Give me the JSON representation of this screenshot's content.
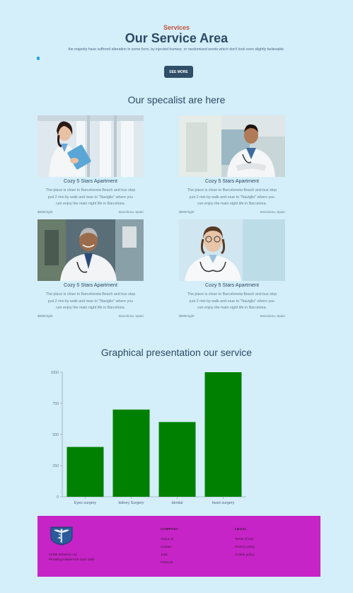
{
  "header": {
    "label": "Services",
    "title": "Our Service Area",
    "subtitle": "the majority have suffered alteration in some form, by injected humour, or randomised words which don't look even slightly believable.",
    "button": "SEE MORE"
  },
  "specialists": {
    "heading": "Our specalist are here",
    "cards": [
      {
        "title": "Cozy 5 Stars Apartment",
        "desc1": "The place is close to Barceloneta Beach and bus stop",
        "desc2": "just 2 min by walk and near to \"Naviglio\" where you",
        "desc3": "can enjoy the main night life in Barcelona.",
        "price": "$699/night",
        "location": "Barcelona, Spain"
      },
      {
        "title": "Cozy 5 Stars Apartment",
        "desc1": "The place is close to Barceloneta Beach and bus stop",
        "desc2": "just 2 min by walk and near to \"Naviglio\" where you",
        "desc3": "can enjoy the main night life in Barcelona.",
        "price": "$699/night",
        "location": "Barcelona, Spain"
      },
      {
        "title": "Cozy 5 Stars Apartment",
        "desc1": "The place is close to Barceloneta Beach and bus stop",
        "desc2": "just 2 min by walk and near to \"Naviglio\" where you",
        "desc3": "can enjoy the main night life in Barcelona.",
        "price": "$699/night",
        "location": "Barcelona, Spain"
      },
      {
        "title": "Cozy 5 Stars Apartment",
        "desc1": "The place is close to Barceloneta Beach and bus stop",
        "desc2": "just 2 min by walk and near to \"Naviglio\" where you",
        "desc3": "can enjoy the main night life in Barcelona.",
        "price": "$699/night",
        "location": "Barcelona, Spain"
      }
    ]
  },
  "graph": {
    "heading": "Graphical presentation our service"
  },
  "chart_data": {
    "type": "bar",
    "categories": [
      "Eyes surgery",
      "kidney Surgery",
      "dential",
      "heart surgery"
    ],
    "values": [
      400,
      700,
      600,
      1000
    ],
    "yticks": [
      "0",
      "250",
      "500",
      "750",
      "1000"
    ],
    "ylim": [
      0,
      1000
    ],
    "grid": false,
    "bar_color": "#008000"
  },
  "footer": {
    "line1": "ACME Industries Ltd.",
    "line2": "Providing reliable tech since 1992",
    "company_heading": "COMPANY",
    "company_links": [
      "About us",
      "Contact",
      "Jobs",
      "Press kit"
    ],
    "legal_heading": "LEGAL",
    "legal_links": [
      "Terms of use",
      "Privacy policy",
      "Cookie policy"
    ],
    "bg_color": "#c624c6"
  }
}
